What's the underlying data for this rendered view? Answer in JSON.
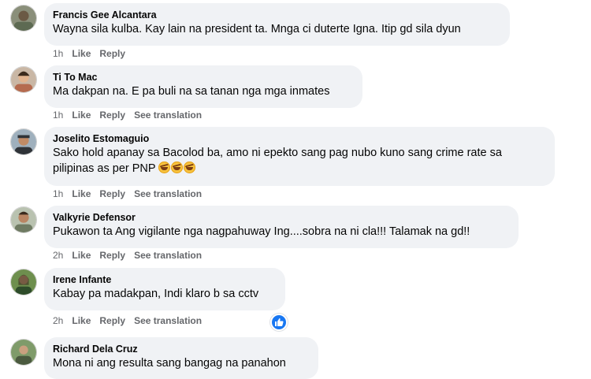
{
  "comments": [
    {
      "name": "Francis Gee Alcantara",
      "text": "Wayna sila kulba. Kay lain na president ta. Mnga ci duterte Igna. Itip gd sila dyun",
      "time": "1h",
      "like": "Like",
      "reply": "Reply"
    },
    {
      "name": "Ti To Mac",
      "text": "Ma dakpan na. E pa buli na sa tanan nga mga inmates",
      "time": "1h",
      "like": "Like",
      "reply": "Reply",
      "translate": "See translation"
    },
    {
      "name": "Joselito Estomaguio",
      "text_line1": "Sako hold apanay sa Bacolod ba, amo ni epekto sang pag nubo kuno sang crime rate sa",
      "text_line2": "pilipinas as per PNP",
      "emoji": "rofl-emoji",
      "time": "1h",
      "like": "Like",
      "reply": "Reply",
      "translate": "See translation"
    },
    {
      "name": "Valkyrie Defensor",
      "text": "Pukawon ta Ang vigilante nga nagpahuway Ing....sobra na ni cla!!! Talamak na gd!!",
      "time": "2h",
      "like": "Like",
      "reply": "Reply",
      "translate": "See translation"
    },
    {
      "name": "Irene Infante",
      "text": "Kabay pa madakpan, Indi klaro b sa cctv",
      "time": "2h",
      "like": "Like",
      "reply": "Reply",
      "translate": "See translation",
      "reaction": "like-reaction-icon"
    },
    {
      "name": "Richard Dela Cruz",
      "text": "Mona ni ang resulta sang bangag na panahon"
    }
  ],
  "colors": {
    "bubble": "#f0f2f5",
    "meta_text": "#65676b",
    "like_blue": "#1877f2"
  }
}
